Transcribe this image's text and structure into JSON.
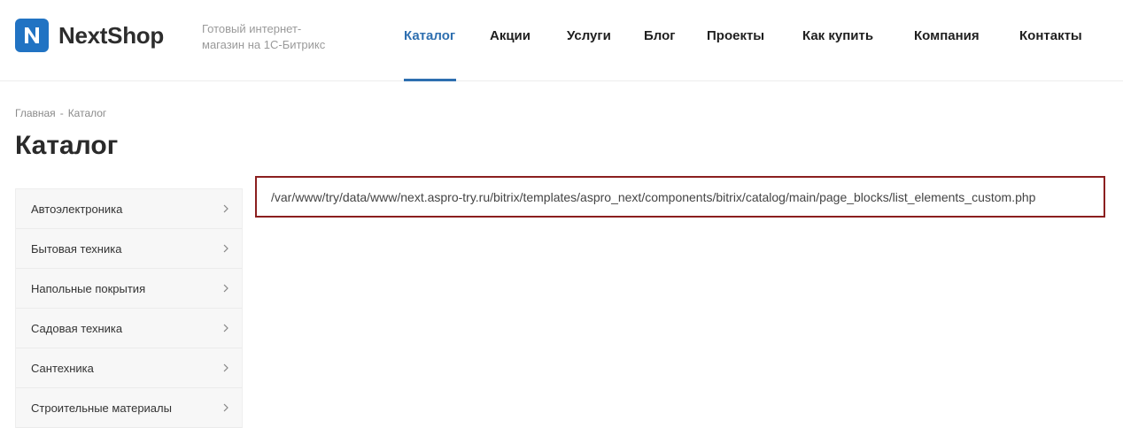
{
  "brand": {
    "logo_text": "NextShop",
    "tagline": "Готовый интернет-магазин на 1С-Битрикс",
    "color": "#2173c3"
  },
  "nav": {
    "items": [
      {
        "label": "Каталог",
        "active": true
      },
      {
        "label": "Акции"
      },
      {
        "label": "Услуги"
      },
      {
        "label": "Блог"
      },
      {
        "label": "Проекты"
      },
      {
        "label": "Как купить"
      },
      {
        "label": "Компания"
      },
      {
        "label": "Контакты"
      }
    ],
    "active_color": "#2e6fb0"
  },
  "breadcrumb": {
    "home": "Главная",
    "separator": "-",
    "current": "Каталог"
  },
  "page": {
    "title": "Каталог"
  },
  "sidebar": {
    "items": [
      {
        "label": "Автоэлектроника",
        "icon": "chevron-right-icon"
      },
      {
        "label": "Бытовая техника",
        "icon": "chevron-right-icon"
      },
      {
        "label": "Напольные покрытия",
        "icon": "chevron-right-icon"
      },
      {
        "label": "Садовая техника",
        "icon": "chevron-right-icon"
      },
      {
        "label": "Сантехника",
        "icon": "chevron-right-icon"
      },
      {
        "label": "Строительные материалы",
        "icon": "chevron-right-icon"
      }
    ]
  },
  "debug": {
    "path": "/var/www/try/data/www/next.aspro-try.ru/bitrix/templates/aspro_next/components/bitrix/catalog/main/page_blocks/list_elements_custom.php",
    "border_color": "#8b1f1f"
  }
}
